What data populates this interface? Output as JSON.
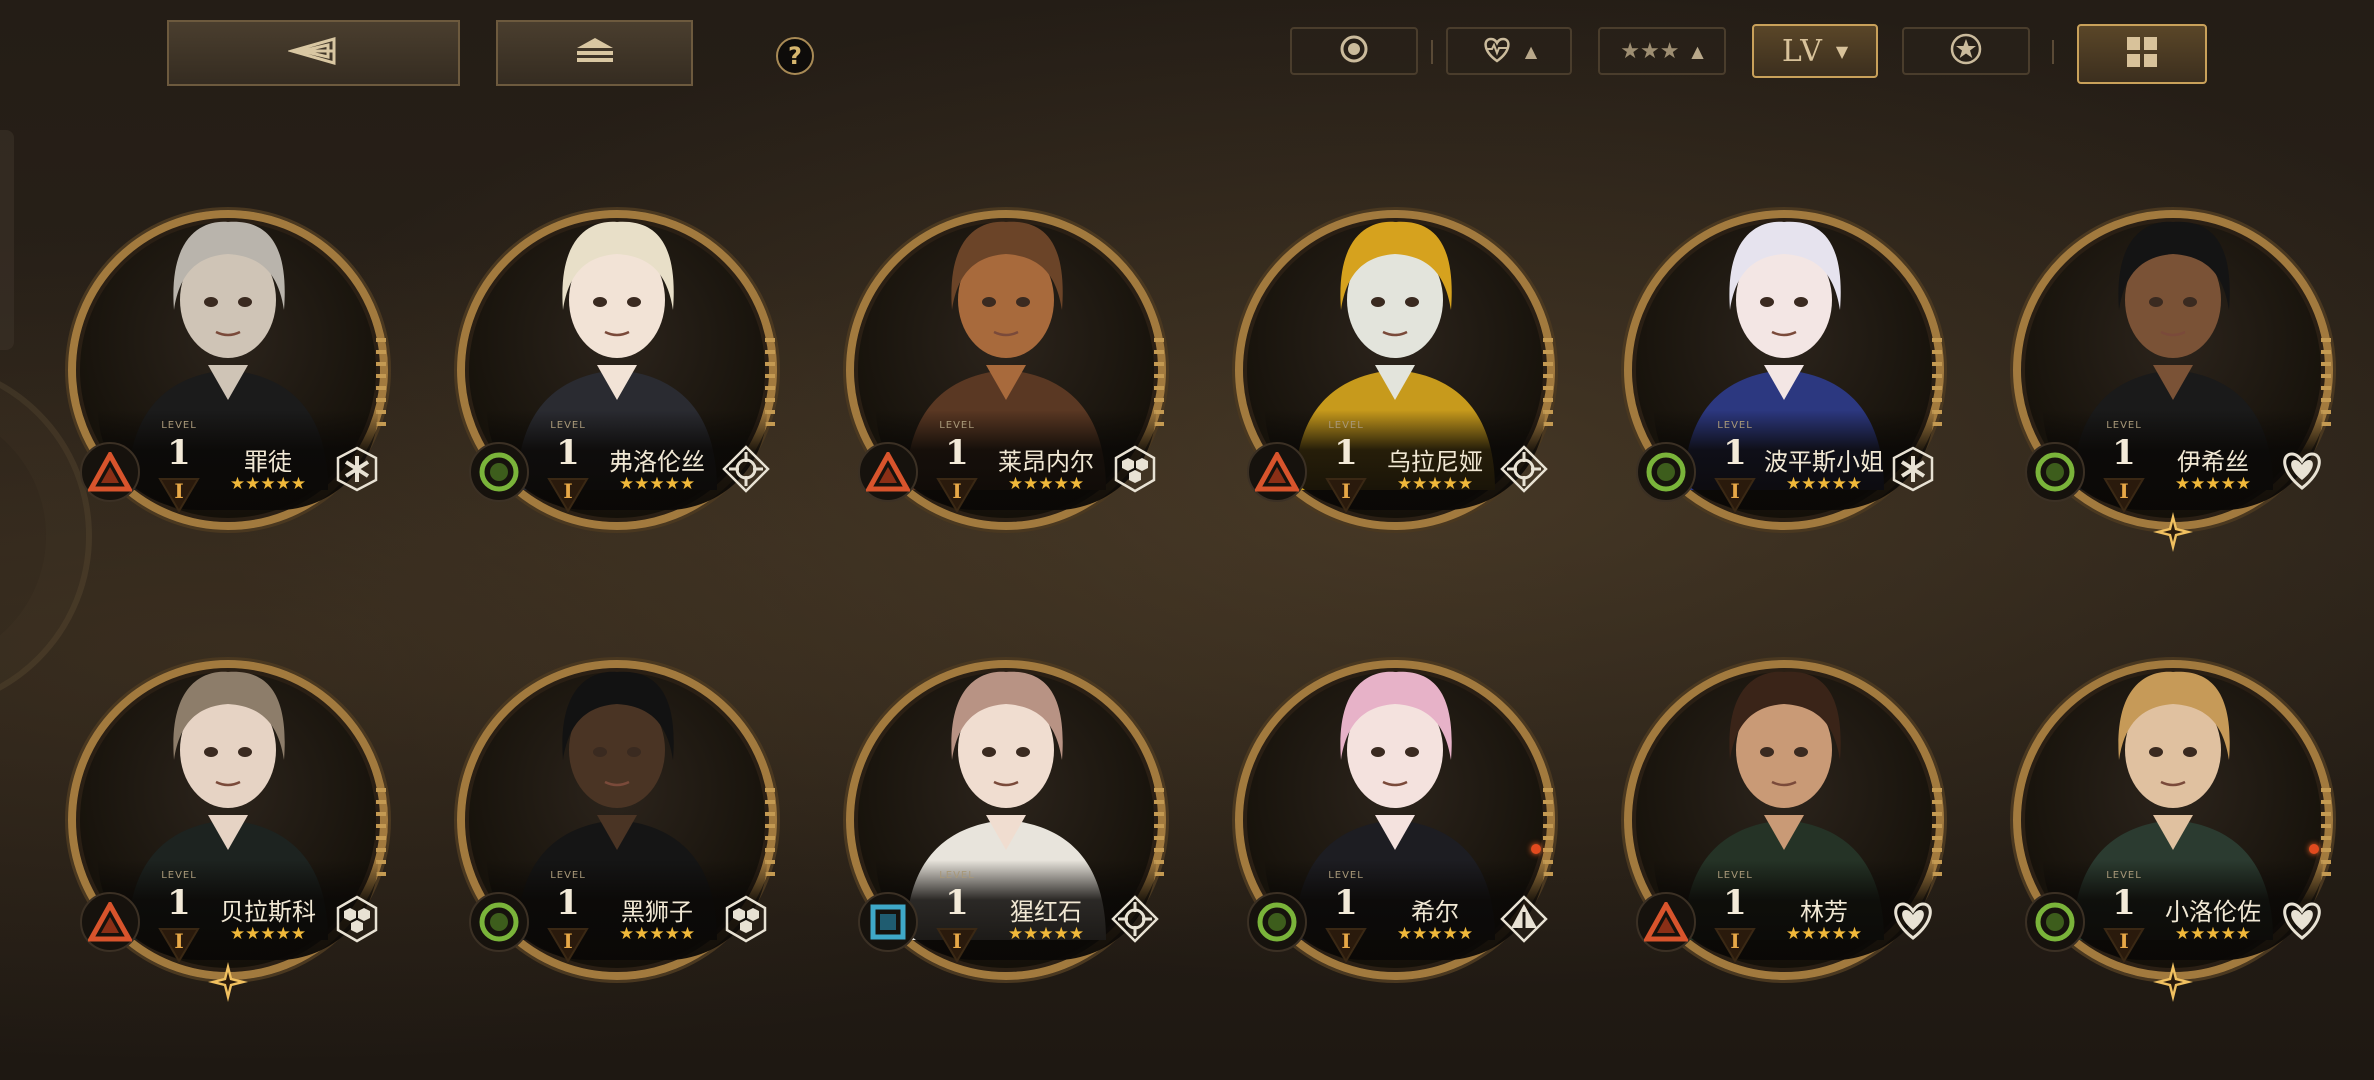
{
  "toolbar": {
    "back_icon": "back-arrow-icon",
    "home_icon": "home-stack-icon",
    "help_label": "?",
    "sort_buttons": [
      {
        "id": "rarity-filter",
        "icon": "circle-dot-icon"
      },
      {
        "id": "affection",
        "icon": "heart-pulse-icon"
      },
      {
        "id": "stars",
        "icon": "three-stars-icon"
      },
      {
        "id": "level",
        "label": "LV",
        "active": true
      },
      {
        "id": "favorite",
        "icon": "star-circle-icon"
      }
    ],
    "view_toggle_icon": "grid-view-icon"
  },
  "level_caption": "LEVEL",
  "star_glyphs": "★★★★★",
  "characters": [
    {
      "name": "罪徒",
      "level": "1",
      "rank": "I",
      "attr": "triangle",
      "class_icon": "snowflake-icon"
    },
    {
      "name": "弗洛伦丝",
      "level": "1",
      "rank": "I",
      "attr": "circle",
      "class_icon": "crosshair-icon"
    },
    {
      "name": "莱昂内尔",
      "level": "1",
      "rank": "I",
      "attr": "triangle",
      "class_icon": "hex-cluster-icon"
    },
    {
      "name": "乌拉尼娅",
      "level": "1",
      "rank": "I",
      "attr": "triangle",
      "class_icon": "crosshair-icon"
    },
    {
      "name": "波平斯小姐",
      "level": "1",
      "rank": "I",
      "attr": "circle",
      "class_icon": "snowflake-icon"
    },
    {
      "name": "伊希丝",
      "level": "1",
      "rank": "I",
      "attr": "circle",
      "class_icon": "heart-icon"
    },
    {
      "name": "贝拉斯科",
      "level": "1",
      "rank": "I",
      "attr": "triangle",
      "class_icon": "hex-cluster-icon"
    },
    {
      "name": "黑狮子",
      "level": "1",
      "rank": "I",
      "attr": "circle",
      "class_icon": "hex-cluster-icon"
    },
    {
      "name": "猩红石",
      "level": "1",
      "rank": "I",
      "attr": "square",
      "class_icon": "crosshair-icon"
    },
    {
      "name": "希尔",
      "level": "1",
      "rank": "I",
      "attr": "circle",
      "class_icon": "tent-icon"
    },
    {
      "name": "林芳",
      "level": "1",
      "rank": "I",
      "attr": "triangle",
      "class_icon": "heart-icon"
    },
    {
      "name": "小洛伦佐",
      "level": "1",
      "rank": "I",
      "attr": "circle",
      "class_icon": "heart-icon"
    }
  ],
  "colors": {
    "gold": "#c9a15a",
    "attr_triangle": "#d8542c",
    "attr_circle": "#7ab43a",
    "attr_square": "#3fa8c8",
    "star": "#f0b83a",
    "rank": "#e7a847"
  }
}
